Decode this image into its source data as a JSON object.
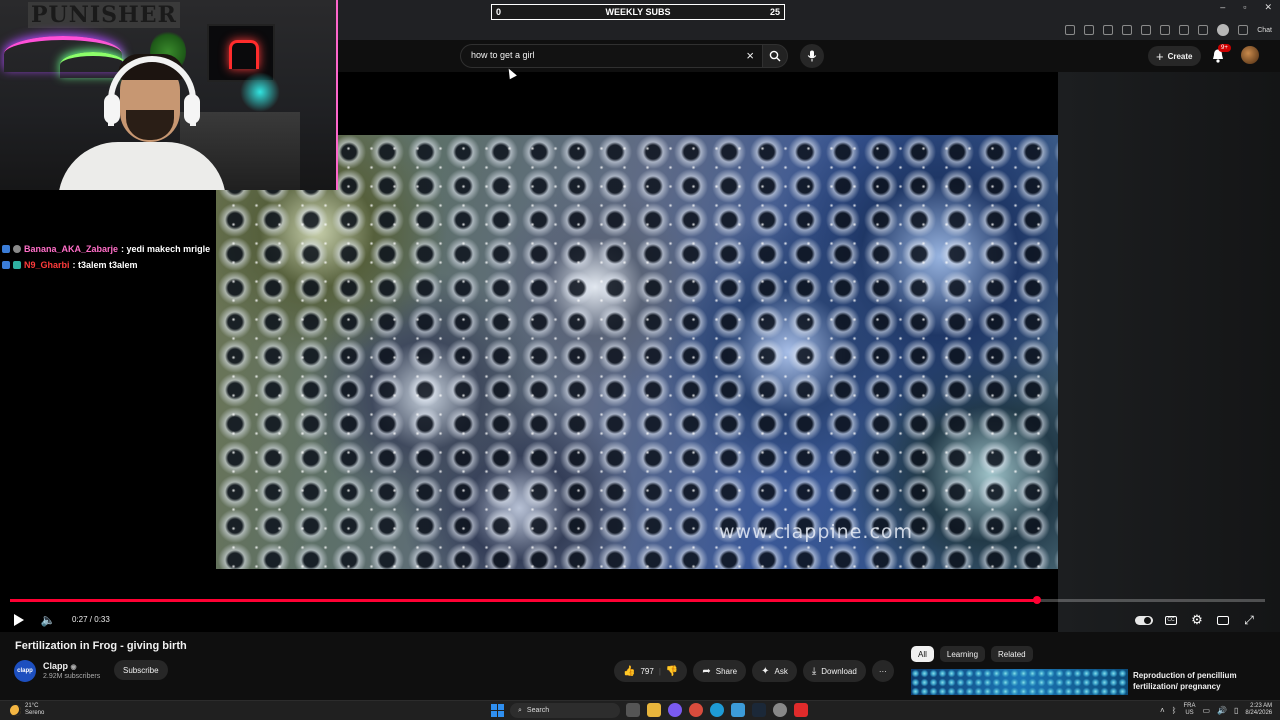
{
  "stream_overlay": {
    "subs_goal": {
      "current": "0",
      "label": "WEEKLY SUBS",
      "target": "25"
    },
    "chat": [
      {
        "user": "Banana_AKA_Zabarje",
        "message": ": yedi makech mrigle",
        "user_color": "#ff6ec7"
      },
      {
        "user": "N9_Gharbi",
        "message": ": t3alem t3alem",
        "user_color": "#ff3b3b"
      }
    ],
    "webcam_sign": "PUNISHER"
  },
  "browser": {
    "window_controls": [
      "–",
      "▫",
      "✕"
    ],
    "chat_label": "Chat"
  },
  "masthead": {
    "search_value": "how to get a girl",
    "create_label": "Create",
    "notification_count": "9+"
  },
  "player": {
    "watermark": "www.clappine.com",
    "current_time": "0:27",
    "duration": "0:33",
    "time_display": "0:27 / 0:33",
    "progress_fraction": 0.818,
    "cc_label": "CC"
  },
  "video_info": {
    "title": "Fertilization in Frog - giving birth",
    "channel": {
      "name": "Clapp",
      "avatar_text": "clapp",
      "subscribers": "2.92M subscribers",
      "verified": true
    },
    "subscribe_label": "Subscribe",
    "actions": {
      "likes": "797",
      "share": "Share",
      "ask": "Ask",
      "download": "Download"
    }
  },
  "related": {
    "chips": [
      "All",
      "Learning",
      "Related"
    ],
    "active_chip": "All",
    "first_item_title": "Reproduction of pencillium fertilization/ pregnancy"
  },
  "taskbar": {
    "weather_temp": "21°C",
    "weather_desc": "Sereno",
    "search_placeholder": "Search",
    "lang_top": "FRA",
    "lang_bottom": "US",
    "time": "2:23 AM",
    "date": "8/24/2026"
  },
  "colors": {
    "progress": "#ff0033",
    "background": "#0f0f0f",
    "chip_active": "#f1f1f1",
    "windows_blue": "#2f8ff0"
  },
  "icons": {
    "search": "search-icon",
    "clear": "close-icon",
    "mic": "mic-icon",
    "bell": "bell-icon",
    "play": "play-icon",
    "volume": "volume-icon",
    "settings": "gear-icon",
    "fullscreen": "fullscreen-icon",
    "like": "thumbs-up-icon",
    "dislike": "thumbs-down-icon",
    "share": "share-icon",
    "ask": "sparkle-icon",
    "download": "download-icon"
  }
}
